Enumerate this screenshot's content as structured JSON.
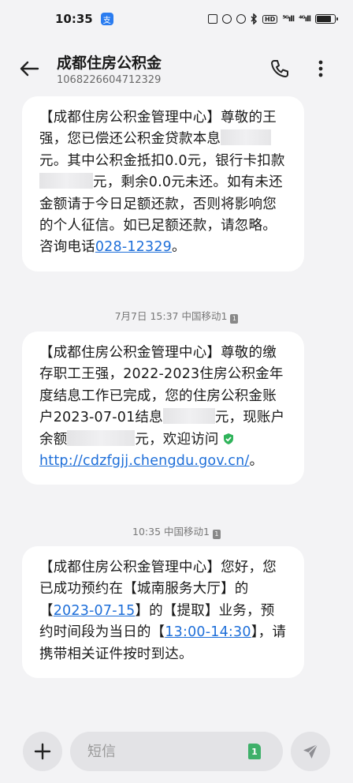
{
  "status_bar": {
    "time": "10:35",
    "app_badge": "支",
    "hd_label": "HD",
    "signal1": "⁵ᴳıll",
    "signal2": "⁴ᴳıll",
    "battery_level": 0.8
  },
  "header": {
    "title": "成都住房公积金",
    "number": "1068226604712329"
  },
  "messages": [
    {
      "lines_a": "【成都住房公积金管理中心】尊敬的王强，您已偿还公积金贷款本息",
      "lines_b": "元。其中公积金抵扣0.0元，银行卡扣款",
      "lines_c": "元，剩余0.0元未还。如有未还金额请于今日足额还款，否则将影响您的个人征信。如已足额还款，请忽略。咨询电话",
      "phone_link": "028-12329",
      "tail": "。"
    },
    {
      "meta": "7月7日 15:37 中国移动1",
      "sim": "1",
      "lines_a": "【成都住房公积金管理中心】尊敬的缴存职工王强，2022-2023住房公积金年度结息工作已完成，您的住房公积金账户2023-07-01结息",
      "lines_b": "元，现账户余额",
      "lines_c": "元，欢迎访问",
      "url_link": "http://cdzfgjj.chengdu.gov.cn/",
      "tail": "。"
    },
    {
      "meta": "10:35 中国移动1",
      "sim": "1",
      "lines_a": "【成都住房公积金管理中心】您好，您已成功预约在【城南服务大厅】的【",
      "date_link": "2023-07-15",
      "lines_b": "】的【提取】业务，预约时间段为当日的【",
      "time_link": "13:00-14:30",
      "lines_c": "】，请携带相关证件按时到达。"
    }
  ],
  "input_bar": {
    "placeholder": "短信",
    "sim_label": "1"
  },
  "colors": {
    "link": "#1e6fd9",
    "sim_green": "#3fb06a",
    "verified_green": "#2fb35a"
  }
}
